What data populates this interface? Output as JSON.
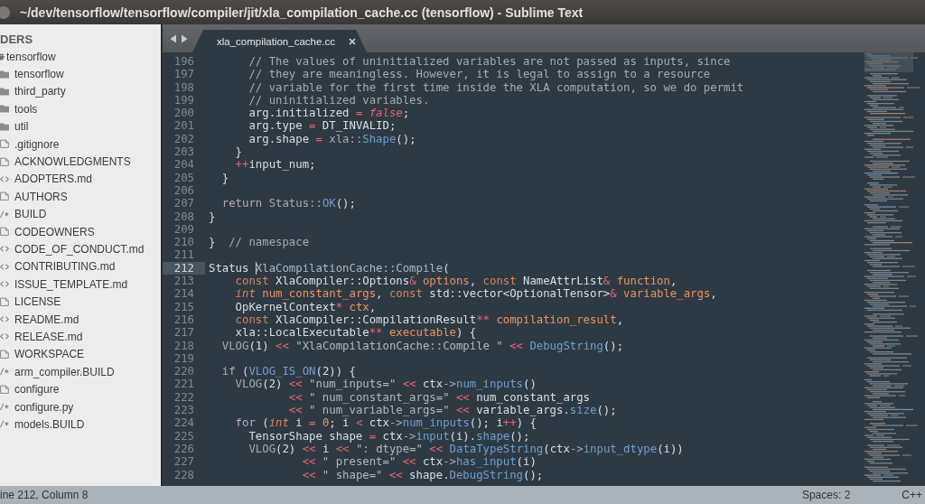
{
  "window": {
    "title": "~/dev/tensorflow/tensorflow/compiler/jit/xla_compilation_cache.cc (tensorflow) - Sublime Text"
  },
  "sidebar": {
    "header": "DERS",
    "items": [
      {
        "name": "tensorflow",
        "kind": "folder",
        "expanded": true,
        "children": [
          {
            "name": "tensorflow",
            "kind": "folder",
            "expanded": false
          },
          {
            "name": "third_party",
            "kind": "folder",
            "expanded": false
          },
          {
            "name": "tools",
            "kind": "folder",
            "expanded": false
          },
          {
            "name": "util",
            "kind": "folder",
            "expanded": false
          },
          {
            "name": ".gitignore",
            "kind": "file"
          },
          {
            "name": "ACKNOWLEDGMENTS",
            "kind": "file"
          },
          {
            "name": "ADOPTERS.md",
            "kind": "markdown"
          },
          {
            "name": "AUTHORS",
            "kind": "file"
          },
          {
            "name": "BUILD",
            "kind": "source"
          },
          {
            "name": "CODEOWNERS",
            "kind": "file"
          },
          {
            "name": "CODE_OF_CONDUCT.md",
            "kind": "markdown"
          },
          {
            "name": "CONTRIBUTING.md",
            "kind": "markdown"
          },
          {
            "name": "ISSUE_TEMPLATE.md",
            "kind": "markdown"
          },
          {
            "name": "LICENSE",
            "kind": "file"
          },
          {
            "name": "README.md",
            "kind": "markdown"
          },
          {
            "name": "RELEASE.md",
            "kind": "markdown"
          },
          {
            "name": "WORKSPACE",
            "kind": "file"
          },
          {
            "name": "arm_compiler.BUILD",
            "kind": "source"
          },
          {
            "name": "configure",
            "kind": "file"
          },
          {
            "name": "configure.py",
            "kind": "source"
          },
          {
            "name": "models.BUILD",
            "kind": "source"
          }
        ]
      }
    ]
  },
  "editor": {
    "tabs": [
      {
        "label": "xla_compilation_cache.cc",
        "selected": true
      }
    ],
    "lines": [
      {
        "number": "196",
        "current": false,
        "tokens": [
          {
            "text": "      // The values of uninitialized variables are not passed as inputs, since",
            "kind": "comment"
          }
        ]
      },
      {
        "number": "197",
        "current": false,
        "tokens": [
          {
            "text": "      // they are meaningless. However, it is legal to assign to a resource",
            "kind": "comment"
          }
        ]
      },
      {
        "number": "198",
        "current": false,
        "tokens": [
          {
            "text": "      // variable for the first time inside the XLA computation, so we do permit",
            "kind": "comment"
          }
        ]
      },
      {
        "number": "199",
        "current": false,
        "tokens": [
          {
            "text": "      // uninitialized variables.",
            "kind": "comment"
          }
        ]
      },
      {
        "number": "200",
        "current": false,
        "tokens": [
          {
            "text": "      arg.initialized ",
            "kind": "plain"
          },
          {
            "text": "= ",
            "kind": "operator"
          },
          {
            "text": "false",
            "kind": "constant"
          },
          {
            "text": ";",
            "kind": "plain"
          }
        ]
      },
      {
        "number": "201",
        "current": false,
        "tokens": [
          {
            "text": "      arg.type ",
            "kind": "plain"
          },
          {
            "text": "=",
            "kind": "operator"
          },
          {
            "text": " DT_INVALID;",
            "kind": "plain"
          }
        ]
      },
      {
        "number": "202",
        "current": false,
        "tokens": [
          {
            "text": "      arg.shape ",
            "kind": "plain"
          },
          {
            "text": "= ",
            "kind": "operator"
          },
          {
            "text": "xla::",
            "kind": "scope"
          },
          {
            "text": "Shape",
            "kind": "function"
          },
          {
            "text": "();",
            "kind": "plain"
          }
        ]
      },
      {
        "number": "203",
        "current": false,
        "tokens": [
          {
            "text": "    }",
            "kind": "plain"
          }
        ]
      },
      {
        "number": "204",
        "current": false,
        "tokens": [
          {
            "text": "    ++",
            "kind": "operator"
          },
          {
            "text": "input_num;",
            "kind": "plain"
          }
        ]
      },
      {
        "number": "205",
        "current": false,
        "tokens": [
          {
            "text": "  }",
            "kind": "plain"
          }
        ]
      },
      {
        "number": "206",
        "current": false
      },
      {
        "number": "207",
        "current": false,
        "tokens": [
          {
            "text": "  return ",
            "kind": "keyword"
          },
          {
            "text": "Status::",
            "kind": "scope"
          },
          {
            "text": "OK",
            "kind": "function"
          },
          {
            "text": "();",
            "kind": "plain"
          }
        ]
      },
      {
        "number": "208",
        "current": false,
        "tokens": [
          {
            "text": "}",
            "kind": "plain"
          }
        ]
      },
      {
        "number": "209",
        "current": false
      },
      {
        "number": "210",
        "current": false,
        "tokens": [
          {
            "text": "}  ",
            "kind": "plain"
          },
          {
            "text": "// namespace",
            "kind": "comment"
          }
        ]
      },
      {
        "number": "211",
        "current": false
      },
      {
        "number": "212",
        "current": true,
        "tokens": [
          {
            "text": "Status ",
            "kind": "plain"
          },
          {
            "kind": "cursor"
          },
          {
            "text": "XlaCompilationCache::Compile",
            "kind": "entity"
          },
          {
            "text": "(",
            "kind": "plain"
          }
        ]
      },
      {
        "number": "213",
        "current": false,
        "tokens": [
          {
            "text": "    const",
            "kind": "storage"
          },
          {
            "text": " XlaCompiler::Options",
            "kind": "plain"
          },
          {
            "text": "& ",
            "kind": "operator"
          },
          {
            "text": "options",
            "kind": "param"
          },
          {
            "text": ", ",
            "kind": "plain"
          },
          {
            "text": "const",
            "kind": "storage"
          },
          {
            "text": " NameAttrList",
            "kind": "plain"
          },
          {
            "text": "& ",
            "kind": "operator"
          },
          {
            "text": "function",
            "kind": "param"
          },
          {
            "text": ",",
            "kind": "plain"
          }
        ]
      },
      {
        "number": "214",
        "current": false,
        "tokens": [
          {
            "text": "    int ",
            "kind": "type"
          },
          {
            "text": "num_constant_args",
            "kind": "param"
          },
          {
            "text": ", ",
            "kind": "plain"
          },
          {
            "text": "const",
            "kind": "storage"
          },
          {
            "text": " std::vector<OptionalTensor>",
            "kind": "plain"
          },
          {
            "text": "& ",
            "kind": "operator"
          },
          {
            "text": "variable_args",
            "kind": "param"
          },
          {
            "text": ",",
            "kind": "plain"
          }
        ]
      },
      {
        "number": "215",
        "current": false,
        "tokens": [
          {
            "text": "    OpKernelContext",
            "kind": "plain"
          },
          {
            "text": "* ",
            "kind": "operator"
          },
          {
            "text": "ctx",
            "kind": "param"
          },
          {
            "text": ",",
            "kind": "plain"
          }
        ]
      },
      {
        "number": "216",
        "current": false,
        "tokens": [
          {
            "text": "    const",
            "kind": "storage"
          },
          {
            "text": " XlaCompiler::CompilationResult",
            "kind": "plain"
          },
          {
            "text": "** ",
            "kind": "operator"
          },
          {
            "text": "compilation_result",
            "kind": "param"
          },
          {
            "text": ",",
            "kind": "plain"
          }
        ]
      },
      {
        "number": "217",
        "current": false,
        "tokens": [
          {
            "text": "    xla::LocalExecutable",
            "kind": "plain"
          },
          {
            "text": "** ",
            "kind": "operator"
          },
          {
            "text": "executable",
            "kind": "param"
          },
          {
            "text": ") {",
            "kind": "plain"
          }
        ]
      },
      {
        "number": "218",
        "current": false,
        "tokens": [
          {
            "text": "  VLOG",
            "kind": "macro"
          },
          {
            "text": "(1) ",
            "kind": "plain"
          },
          {
            "text": "<< ",
            "kind": "operator"
          },
          {
            "text": "\"XlaCompilationCache::Compile \"",
            "kind": "string"
          },
          {
            "text": " << ",
            "kind": "operator"
          },
          {
            "text": "DebugString",
            "kind": "function"
          },
          {
            "text": "();",
            "kind": "plain"
          }
        ]
      },
      {
        "number": "219",
        "current": false
      },
      {
        "number": "220",
        "current": false,
        "tokens": [
          {
            "text": "  if",
            "kind": "keyword"
          },
          {
            "text": " (",
            "kind": "plain"
          },
          {
            "text": "VLOG_IS_ON",
            "kind": "function"
          },
          {
            "text": "(2)) {",
            "kind": "plain"
          }
        ]
      },
      {
        "number": "221",
        "current": false,
        "tokens": [
          {
            "text": "    VLOG",
            "kind": "macro"
          },
          {
            "text": "(2) ",
            "kind": "plain"
          },
          {
            "text": "<< ",
            "kind": "operator"
          },
          {
            "text": "\"num_inputs=\"",
            "kind": "string"
          },
          {
            "text": " <<",
            "kind": "operator"
          },
          {
            "text": " ctx",
            "kind": "plain"
          },
          {
            "text": "->",
            "kind": "punct"
          },
          {
            "text": "num_inputs",
            "kind": "function"
          },
          {
            "text": "()",
            "kind": "plain"
          }
        ]
      },
      {
        "number": "222",
        "current": false,
        "tokens": [
          {
            "text": "            << ",
            "kind": "operator"
          },
          {
            "text": "\" num_constant_args=\"",
            "kind": "string"
          },
          {
            "text": " <<",
            "kind": "operator"
          },
          {
            "text": " num_constant_args",
            "kind": "plain"
          }
        ]
      },
      {
        "number": "223",
        "current": false,
        "tokens": [
          {
            "text": "            << ",
            "kind": "operator"
          },
          {
            "text": "\" num_variable_args=\"",
            "kind": "string"
          },
          {
            "text": " <<",
            "kind": "operator"
          },
          {
            "text": " variable_args.",
            "kind": "plain"
          },
          {
            "text": "size",
            "kind": "function"
          },
          {
            "text": "();",
            "kind": "plain"
          }
        ]
      },
      {
        "number": "224",
        "current": false,
        "tokens": [
          {
            "text": "    for",
            "kind": "keyword"
          },
          {
            "text": " (",
            "kind": "plain"
          },
          {
            "text": "int",
            "kind": "type"
          },
          {
            "text": " i ",
            "kind": "plain"
          },
          {
            "text": "= ",
            "kind": "operator"
          },
          {
            "text": "0",
            "kind": "number"
          },
          {
            "text": "; i ",
            "kind": "plain"
          },
          {
            "text": "<",
            "kind": "operator"
          },
          {
            "text": " ctx",
            "kind": "plain"
          },
          {
            "text": "->",
            "kind": "punct"
          },
          {
            "text": "num_inputs",
            "kind": "function"
          },
          {
            "text": "(); i",
            "kind": "plain"
          },
          {
            "text": "++",
            "kind": "operator"
          },
          {
            "text": ") {",
            "kind": "plain"
          }
        ]
      },
      {
        "number": "225",
        "current": false,
        "tokens": [
          {
            "text": "      TensorShape shape ",
            "kind": "plain"
          },
          {
            "text": "=",
            "kind": "operator"
          },
          {
            "text": " ctx",
            "kind": "plain"
          },
          {
            "text": "->",
            "kind": "punct"
          },
          {
            "text": "input",
            "kind": "function"
          },
          {
            "text": "(i).",
            "kind": "plain"
          },
          {
            "text": "shape",
            "kind": "function"
          },
          {
            "text": "();",
            "kind": "plain"
          }
        ]
      },
      {
        "number": "226",
        "current": false,
        "tokens": [
          {
            "text": "      VLOG",
            "kind": "macro"
          },
          {
            "text": "(2) ",
            "kind": "plain"
          },
          {
            "text": "<<",
            "kind": "operator"
          },
          {
            "text": " i ",
            "kind": "plain"
          },
          {
            "text": "<< ",
            "kind": "operator"
          },
          {
            "text": "\": dtype=\"",
            "kind": "string"
          },
          {
            "text": " << ",
            "kind": "operator"
          },
          {
            "text": "DataTypeString",
            "kind": "function"
          },
          {
            "text": "(ctx",
            "kind": "plain"
          },
          {
            "text": "->",
            "kind": "punct"
          },
          {
            "text": "input_dtype",
            "kind": "function"
          },
          {
            "text": "(i))",
            "kind": "plain"
          }
        ]
      },
      {
        "number": "227",
        "current": false,
        "tokens": [
          {
            "text": "              << ",
            "kind": "operator"
          },
          {
            "text": "\" present=\"",
            "kind": "string"
          },
          {
            "text": " <<",
            "kind": "operator"
          },
          {
            "text": " ctx",
            "kind": "plain"
          },
          {
            "text": "->",
            "kind": "punct"
          },
          {
            "text": "has_input",
            "kind": "function"
          },
          {
            "text": "(i)",
            "kind": "plain"
          }
        ]
      },
      {
        "number": "228",
        "current": false,
        "tokens": [
          {
            "text": "              << ",
            "kind": "operator"
          },
          {
            "text": "\" shape=\"",
            "kind": "string"
          },
          {
            "text": " <<",
            "kind": "operator"
          },
          {
            "text": " shape.",
            "kind": "plain"
          },
          {
            "text": "DebugString",
            "kind": "function"
          },
          {
            "text": "();",
            "kind": "plain"
          }
        ]
      }
    ]
  },
  "status_bar": {
    "position": "ine 212, Column 8",
    "indentation": "Spaces: 2",
    "syntax": "C++"
  }
}
